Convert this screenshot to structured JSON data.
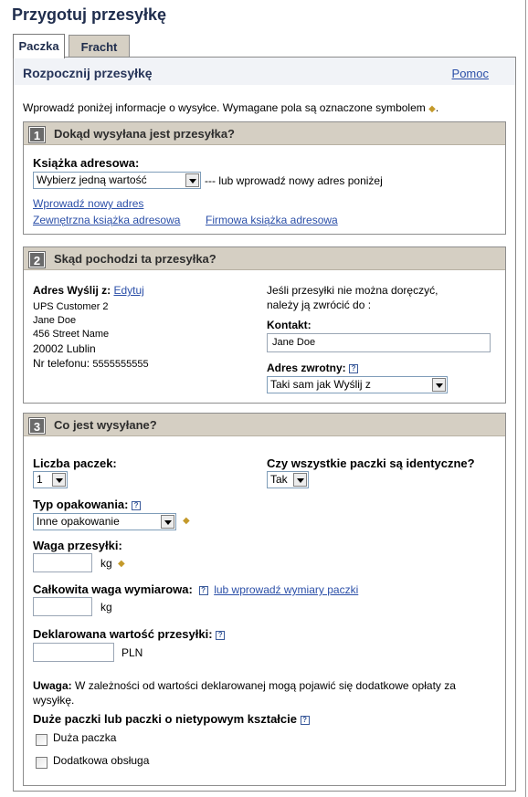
{
  "page_title": "Przygotuj przesyłkę",
  "tabs": [
    {
      "label": "Paczka",
      "active": true
    },
    {
      "label": "Fracht",
      "active": false
    }
  ],
  "panel": {
    "title": "Rozpocznij przesyłkę",
    "help_link": "Pomoc",
    "intro": "Wprowadź poniżej informacje o wysyłce. Wymagane pola są oznaczone symbolem",
    "intro_end": "."
  },
  "section1": {
    "number": "1",
    "title": "Dokąd wysyłana jest przesyłka?",
    "address_book_label": "Książka adresowa:",
    "address_book_select": "Wybierz jedną wartość",
    "or_text": "--- lub wprowadź nowy adres poniżej",
    "new_address_link": "Wprowadź nowy adres",
    "external_book_link": "Zewnętrzna książka adresowa",
    "company_book_link": "Firmowa książka adresowa"
  },
  "section2": {
    "number": "2",
    "title": "Skąd pochodzi ta przesyłka?",
    "ship_from_label": "Adres Wyślij z:",
    "edit_link": "Edytuj",
    "address_lines": [
      "UPS Customer 2",
      "Jane Doe",
      "456 Street Name"
    ],
    "postal_city": "20002 Lublin",
    "phone_label": "Nr telefonu:",
    "phone_value": "5555555555",
    "return_note_1": "Jeśli przesyłki nie można doręczyć,",
    "return_note_2": "należy ją zwrócić do :",
    "contact_label": "Kontakt:",
    "contact_value": "Jane Doe",
    "return_address_label": "Adres zwrotny:",
    "return_address_select": "Taki sam jak Wyślij z"
  },
  "section3": {
    "number": "3",
    "title": "Co jest wysyłane?",
    "packages_count_label": "Liczba paczek:",
    "packages_count_value": "1",
    "identical_label": "Czy wszystkie paczki są identyczne?",
    "identical_value": "Tak",
    "packaging_type_label": "Typ opakowania:",
    "packaging_type_value": "Inne opakowanie",
    "weight_label": "Waga przesyłki:",
    "weight_value": "",
    "weight_unit": "kg",
    "dim_weight_label": "Całkowita waga wymiarowa:",
    "dim_link": "lub wprowadź wymiary paczki",
    "dim_weight_value": "",
    "dim_weight_unit": "kg",
    "declared_value_label": "Deklarowana wartość przesyłki:",
    "declared_value": "",
    "currency": "PLN",
    "note_label": "Uwaga:",
    "note_text": "W zależności od wartości deklarowanej mogą pojawić się dodatkowe opłaty za",
    "note_text_2": "wysyłkę.",
    "large_label": "Duże paczki lub paczki o nietypowym kształcie",
    "large_package_label": "Duża paczka",
    "additional_handling_label": "Dodatkowa obsługa"
  },
  "help_icon_glyph": "?",
  "required_symbol": "◆",
  "colors": {
    "section_header": "#d5cfc3",
    "link": "#2b4fa8",
    "title": "#1f2d4d",
    "required": "#c49a2b"
  }
}
